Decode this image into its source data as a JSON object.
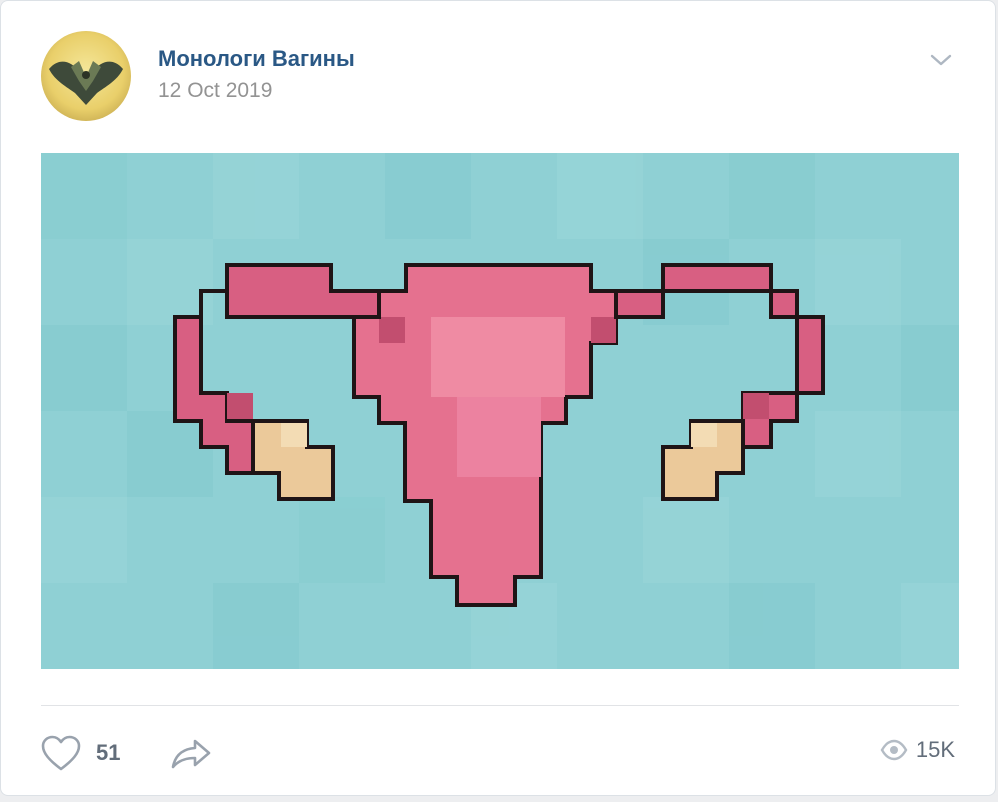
{
  "post": {
    "author": "Монологи Вагины",
    "date": "12 Oct 2019",
    "photo_alt": "pixel-art uterus illustration"
  },
  "footer": {
    "likes": "51",
    "views": "15K"
  },
  "icons": {
    "menu": "chevron-down-icon",
    "like": "heart-icon",
    "share": "share-arrow-icon",
    "views": "eye-icon"
  },
  "colors": {
    "author_link": "#2a5885",
    "muted_text": "#939393",
    "counter_text": "#626d7a",
    "photo_background": "#8fd0d4",
    "uterus_pink": "#e5718f",
    "ovary_beige": "#ebc99a"
  }
}
